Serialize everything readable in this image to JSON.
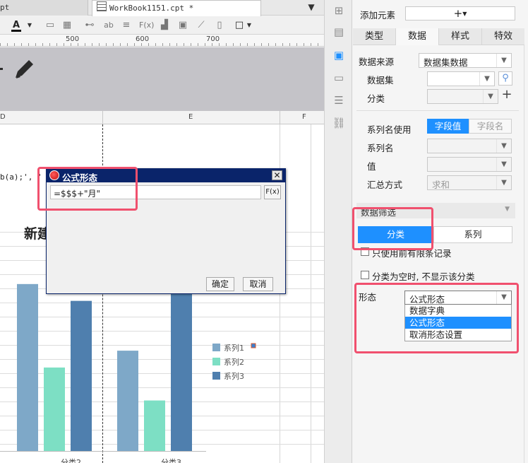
{
  "tabs": [
    {
      "label": "pt"
    },
    {
      "label": "WorkBook1151.cpt *"
    }
  ],
  "ruler": {
    "ticks": [
      "500",
      "600",
      "700"
    ]
  },
  "columns": [
    "D",
    "E",
    "F"
  ],
  "sheet": {
    "formula_fragment": "b(a);', ' ',",
    "chart_title_fragment": "新建"
  },
  "chart_data": {
    "type": "bar",
    "categories": [
      "分类2",
      "分类3"
    ],
    "series": [
      {
        "name": "系列1",
        "values": [
          238,
          143
        ],
        "color": "#7ea8c8"
      },
      {
        "name": "系列2",
        "values": [
          119,
          72
        ],
        "color": "#7ddfc4"
      },
      {
        "name": "系列3",
        "values": [
          214,
          226
        ],
        "color": "#4f7fae"
      }
    ],
    "legend": "right",
    "ylim": [
      0,
      260
    ]
  },
  "dialog": {
    "title": "公式形态",
    "formula": "=$$$+\"月\"",
    "fx_label": "F(x)",
    "ok": "确定",
    "cancel": "取消"
  },
  "panel": {
    "add_element": "添加元素",
    "add_icon": "+",
    "tabs": [
      "类型",
      "数据",
      "样式",
      "特效"
    ],
    "data_source_label": "数据来源",
    "data_source_value": "数据集数据",
    "dataset_label": "数据集",
    "category_label": "分类",
    "series_name_use_label": "系列名使用",
    "field_value_btn": "字段值",
    "field_name_btn": "字段名",
    "series_name_label": "系列名",
    "value_label": "值",
    "summary_label": "汇总方式",
    "summary_value": "求和",
    "data_filter_label": "数据筛选",
    "filter_tabs": [
      "分类",
      "系列"
    ],
    "limited_records": "只使用前有限条记录",
    "hide_empty_category": "分类为空时, 不显示该分类",
    "shape_label": "形态",
    "shape_value": "公式形态",
    "shape_options": [
      "数据字典",
      "公式形态",
      "取消形态设置"
    ]
  },
  "colors": {
    "accent": "#1e90ff",
    "highlight": "#f0506e",
    "dialog_title": "#0a246a"
  }
}
